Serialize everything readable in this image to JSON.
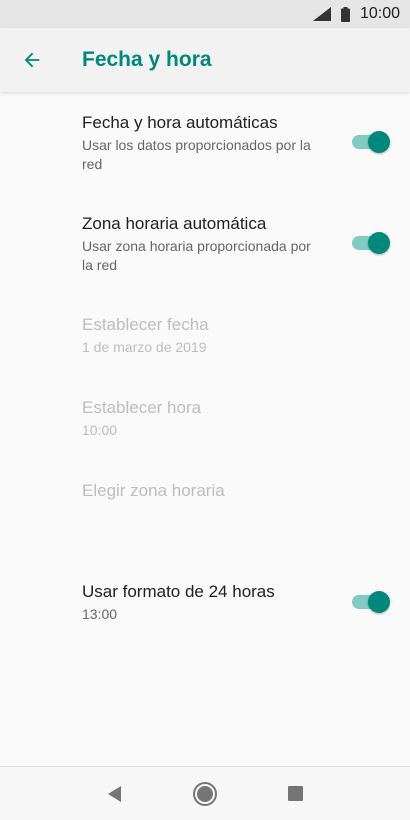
{
  "status_bar": {
    "time": "10:00",
    "signal_icon": "signal-icon",
    "battery_icon": "battery-icon"
  },
  "app_bar": {
    "title": "Fecha y hora",
    "back_icon": "arrow-back-icon"
  },
  "preferences": [
    {
      "title": "Fecha y hora automáticas",
      "summary": "Usar los datos proporcionados por la red",
      "switch_on": true
    },
    {
      "title": "Zona horaria automática",
      "summary": "Usar zona horaria proporcionada por la red",
      "switch_on": true
    },
    {
      "title": "Establecer fecha",
      "summary": "1 de marzo de 2019",
      "enabled": false
    },
    {
      "title": "Establecer hora",
      "summary": "10:00",
      "enabled": false
    },
    {
      "title": "Elegir zona horaria",
      "enabled": false
    },
    {
      "title": "Usar formato de 24 horas",
      "summary": "13:00",
      "switch_on": true
    }
  ],
  "nav_bar": {
    "back_icon": "nav-back-icon",
    "home_icon": "nav-home-icon",
    "recents_icon": "nav-recents-icon"
  },
  "colors": {
    "accent": "#00897b",
    "accent_light": "#80cbc4",
    "disabled_text": "#bdbdbd"
  }
}
